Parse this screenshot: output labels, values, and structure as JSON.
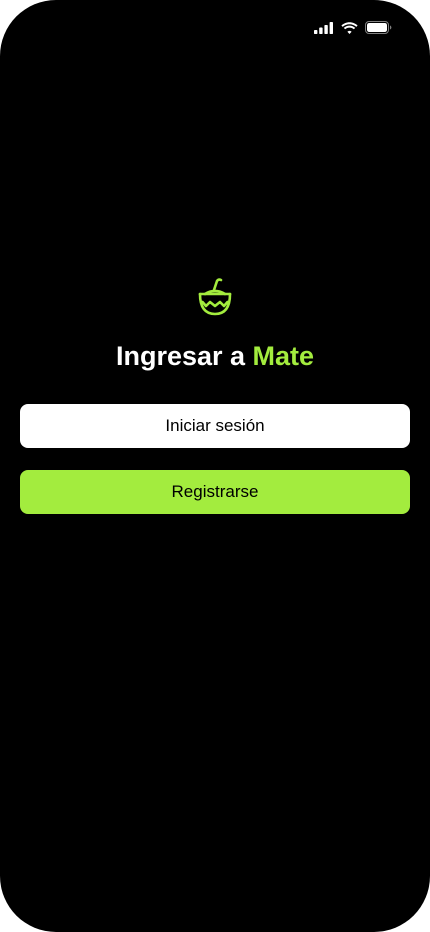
{
  "colors": {
    "background": "#000000",
    "accent": "#a3ec3e",
    "primary_button_bg": "#ffffff",
    "text_on_button": "#000000"
  },
  "status_bar": {
    "icons": [
      "cellular-signal-icon",
      "wifi-icon",
      "battery-icon"
    ]
  },
  "logo": {
    "icon": "mate-gourd-icon"
  },
  "header": {
    "title_prefix": "Ingresar a ",
    "title_brand": "Mate"
  },
  "actions": {
    "login_label": "Iniciar sesión",
    "register_label": "Registrarse"
  }
}
